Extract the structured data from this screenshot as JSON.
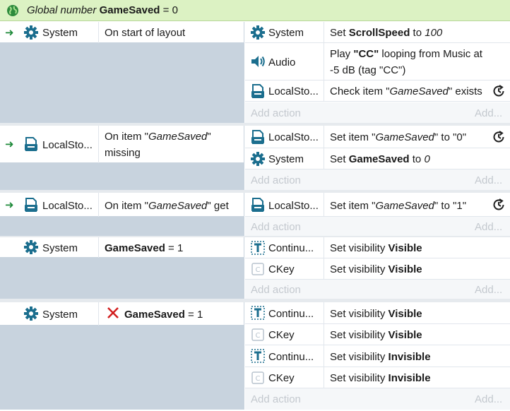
{
  "global_var": {
    "prefix": "Global number",
    "name": "GameSaved",
    "eq": "=",
    "value": "0"
  },
  "events": [
    {
      "condition": {
        "object": "System",
        "text": "On start of layout"
      },
      "actions": [
        {
          "object": "System",
          "parts": [
            "Set ",
            "ScrollSpeed",
            " to ",
            "100"
          ]
        },
        {
          "object": "Audio",
          "line1_pre": "Play ",
          "line1_b": "\"CC\"",
          "line1_post": " looping from Music at",
          "line2": "-5 dB (tag \"CC\")"
        },
        {
          "object": "LocalSto...",
          "pre": "Check item \"",
          "it": "GameSaved",
          "post": "\" exists"
        }
      ],
      "add_action": "Add action",
      "add_short": "Add..."
    },
    {
      "condition": {
        "object": "LocalSto...",
        "pre": "On item \"",
        "it": "GameSaved",
        "post": "\"",
        "line2": "missing"
      },
      "actions": [
        {
          "object": "LocalSto...",
          "pre": "Set item \"",
          "it": "GameSaved",
          "post": "\" to \"0\""
        },
        {
          "object": "System",
          "pre": "Set ",
          "b": "GameSaved",
          "mid": " to ",
          "it": "0"
        }
      ],
      "add_action": "Add action",
      "add_short": "Add..."
    },
    {
      "condition": {
        "object": "LocalSto...",
        "pre": "On item \"",
        "it": "GameSaved",
        "post": "\" get"
      },
      "actions": [
        {
          "object": "LocalSto...",
          "pre": "Set item \"",
          "it": "GameSaved",
          "post": "\" to \"1\""
        }
      ],
      "add_action": "Add action",
      "add_short": "Add...",
      "sub": {
        "condition": {
          "object": "System",
          "b": "GameSaved",
          "post": " = 1"
        },
        "actions": [
          {
            "object": "Continu...",
            "pre": "Set visibility ",
            "b": "Visible"
          },
          {
            "object": "CKey",
            "pre": "Set visibility ",
            "b": "Visible"
          }
        ],
        "add_action": "Add action",
        "add_short": "Add..."
      }
    },
    {
      "condition": {
        "object": "System",
        "b": "GameSaved",
        "post": " = 1"
      },
      "actions": [
        {
          "object": "Continu...",
          "pre": "Set visibility ",
          "b": "Visible"
        },
        {
          "object": "CKey",
          "pre": "Set visibility ",
          "b": "Visible"
        },
        {
          "object": "Continu...",
          "pre": "Set visibility ",
          "b": "Invisible"
        },
        {
          "object": "CKey",
          "pre": "Set visibility ",
          "b": "Invisible"
        }
      ],
      "add_action": "Add action",
      "add_short": "Add..."
    }
  ],
  "colors": {
    "global_bg": "#dcf2c3",
    "panel": "#c8d3de",
    "gear": "#1b6e8e",
    "arrow": "#1f8a3a",
    "invert": "#d21f1f"
  }
}
